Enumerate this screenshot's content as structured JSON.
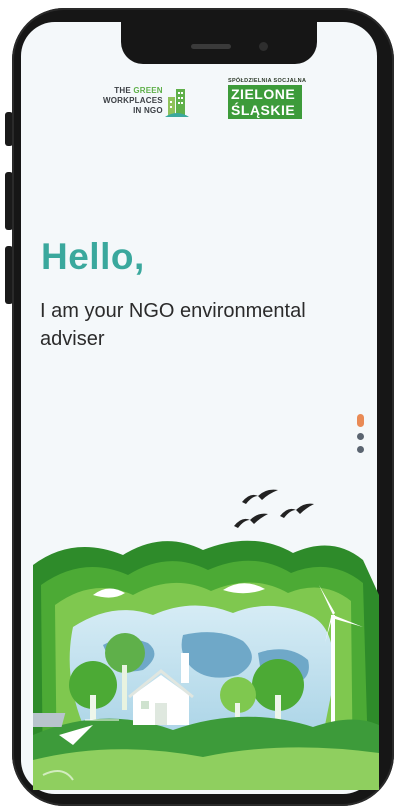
{
  "logos": {
    "green_workplaces": {
      "line1_prefix": "THE ",
      "line1_accent": "GREEN",
      "line2": "WORKPLACES",
      "line3": "IN NGO"
    },
    "zielone": {
      "top": "SPÓŁDZIELNIA SOCJALNA",
      "line1": "ZIELONE",
      "line2": "ŚLĄSKIE"
    }
  },
  "greeting": {
    "title": "Hello,",
    "subtitle": "I am your NGO environmental adviser"
  },
  "pager": {
    "count": 3,
    "active_index": 0
  },
  "colors": {
    "accent": "#3aa89d",
    "active_dot": "#e98a55",
    "inactive_dot": "#5a6470",
    "leaf_green": "#5fb04a"
  },
  "icons": [
    "birds-icon",
    "eco-landscape-illustration",
    "building-icon"
  ]
}
